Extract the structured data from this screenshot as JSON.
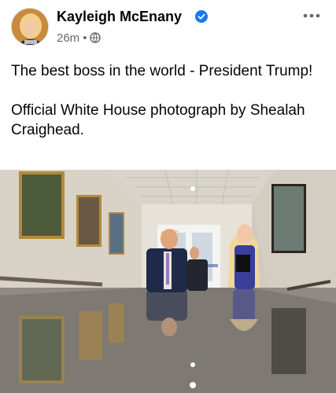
{
  "post": {
    "author": "Kayleigh McEnany",
    "verified_icon": "verified-badge-icon",
    "time": "26m",
    "separator": "•",
    "audience_icon": "globe-icon",
    "more_icon": "more-options-icon",
    "text_line_1": "The best boss in the world - President Trump!",
    "text_line_2": "Official White House photograph by Shealah Craighead."
  },
  "colors": {
    "brand_blue": "#1877f2",
    "meta_gray": "#65676b",
    "text_dark": "#050505"
  }
}
